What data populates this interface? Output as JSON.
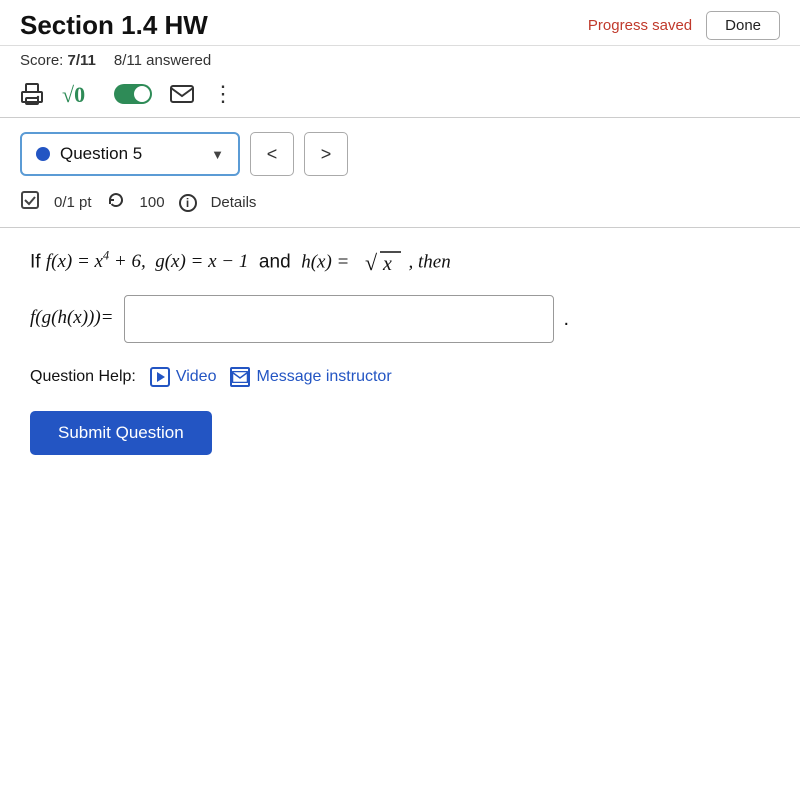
{
  "header": {
    "title": "Section 1.4 HW",
    "progress_saved": "Progress saved",
    "done_label": "Done"
  },
  "score": {
    "label": "Score:",
    "score_value": "7/11",
    "answered": "8/11 answered"
  },
  "toolbar": {
    "print_icon": "print-icon",
    "sqrt_label": "√0",
    "mail_icon": "✉",
    "dots_icon": "⋮"
  },
  "question_selector": {
    "dot_color": "#2355c3",
    "label": "Question 5",
    "prev_label": "<",
    "next_label": ">"
  },
  "points": {
    "score": "0/1 pt",
    "retry": "100",
    "details": "Details"
  },
  "problem": {
    "statement": "If f(x) = x⁴ + 6, g(x) = x − 1 and h(x) = √x, then",
    "answer_prefix": "f(g(h(x)))=",
    "period": "."
  },
  "help": {
    "label": "Question Help:",
    "video_label": "Video",
    "message_label": "Message instructor"
  },
  "submit": {
    "label": "Submit Question"
  }
}
